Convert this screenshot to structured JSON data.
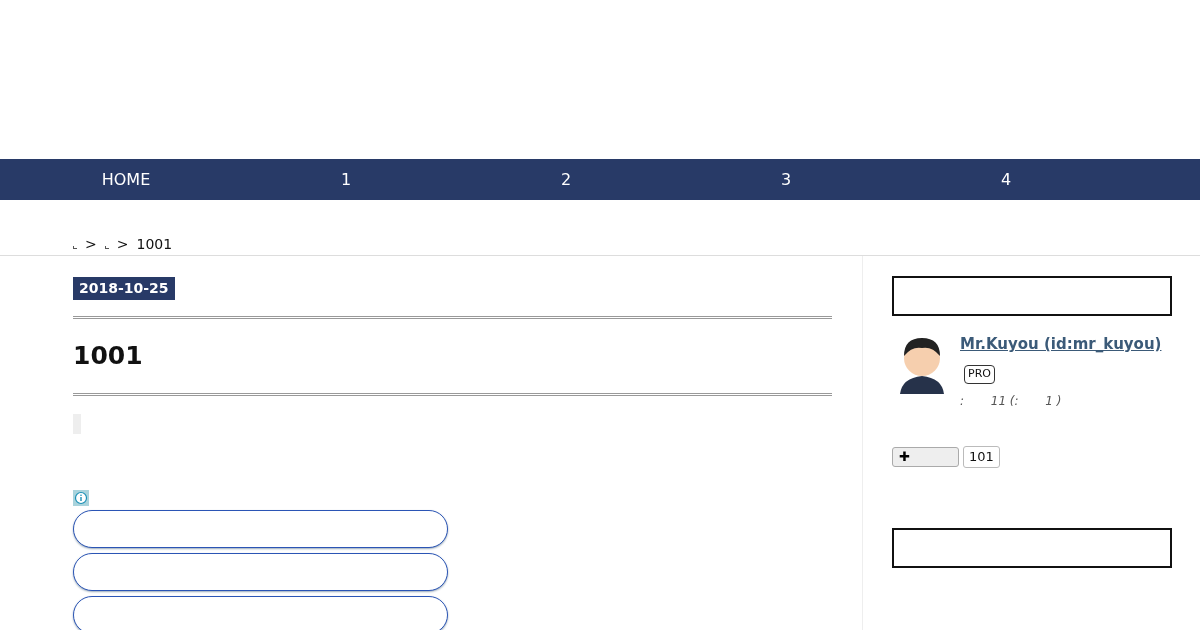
{
  "nav": {
    "items": [
      {
        "label": "HOME"
      },
      {
        "label": "1"
      },
      {
        "label": "2"
      },
      {
        "label": "3"
      },
      {
        "label": "4"
      }
    ]
  },
  "breadcrumb": {
    "separators": [
      ">",
      ">"
    ],
    "current": "1001"
  },
  "article": {
    "date": "2018-10-25",
    "title": "1001"
  },
  "sidebar": {
    "profile": {
      "name": "Mr.Kuyou (id:mr_kuyou)",
      "badge": "PRO",
      "stats": ":       11 (:       1 )"
    },
    "follow": {
      "icon": "✚",
      "count": "101"
    }
  }
}
